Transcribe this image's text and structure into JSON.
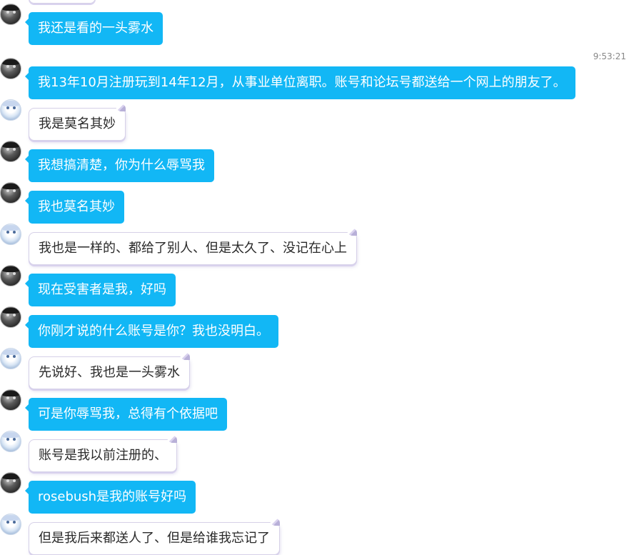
{
  "timestamp": "9:53:21",
  "icons": {
    "avatar_self": "user-avatar-dark",
    "avatar_other": "user-avatar-anime"
  },
  "colors": {
    "outgoing_bubble": "#12b7f5",
    "incoming_bubble": "#ffffff",
    "incoming_border": "#d6d1e8"
  },
  "messages": [
    {
      "sender": "self",
      "text": "我还是看的一头雾水"
    },
    {
      "sender": "self",
      "text": "我13年10月注册玩到14年12月，从事业单位离职。账号和论坛号都送给一个网上的朋友了。"
    },
    {
      "sender": "other",
      "text": "我是莫名其妙"
    },
    {
      "sender": "self",
      "text": "我想搞清楚，你为什么辱骂我"
    },
    {
      "sender": "self",
      "text": "我也莫名其妙"
    },
    {
      "sender": "other",
      "text": "我也是一样的、都给了别人、但是太久了、没记在心上"
    },
    {
      "sender": "self",
      "text": "现在受害者是我，好吗"
    },
    {
      "sender": "self",
      "text": "你刚才说的什么账号是你？我也没明白。"
    },
    {
      "sender": "other",
      "text": "先说好、我也是一头雾水"
    },
    {
      "sender": "self",
      "text": "可是你辱骂我，总得有个依据吧"
    },
    {
      "sender": "other",
      "text": "账号是我以前注册的、"
    },
    {
      "sender": "self",
      "text": "rosebush是我的账号好吗"
    },
    {
      "sender": "other",
      "text": "但是我后来都送人了、但是给谁我忘记了"
    }
  ]
}
